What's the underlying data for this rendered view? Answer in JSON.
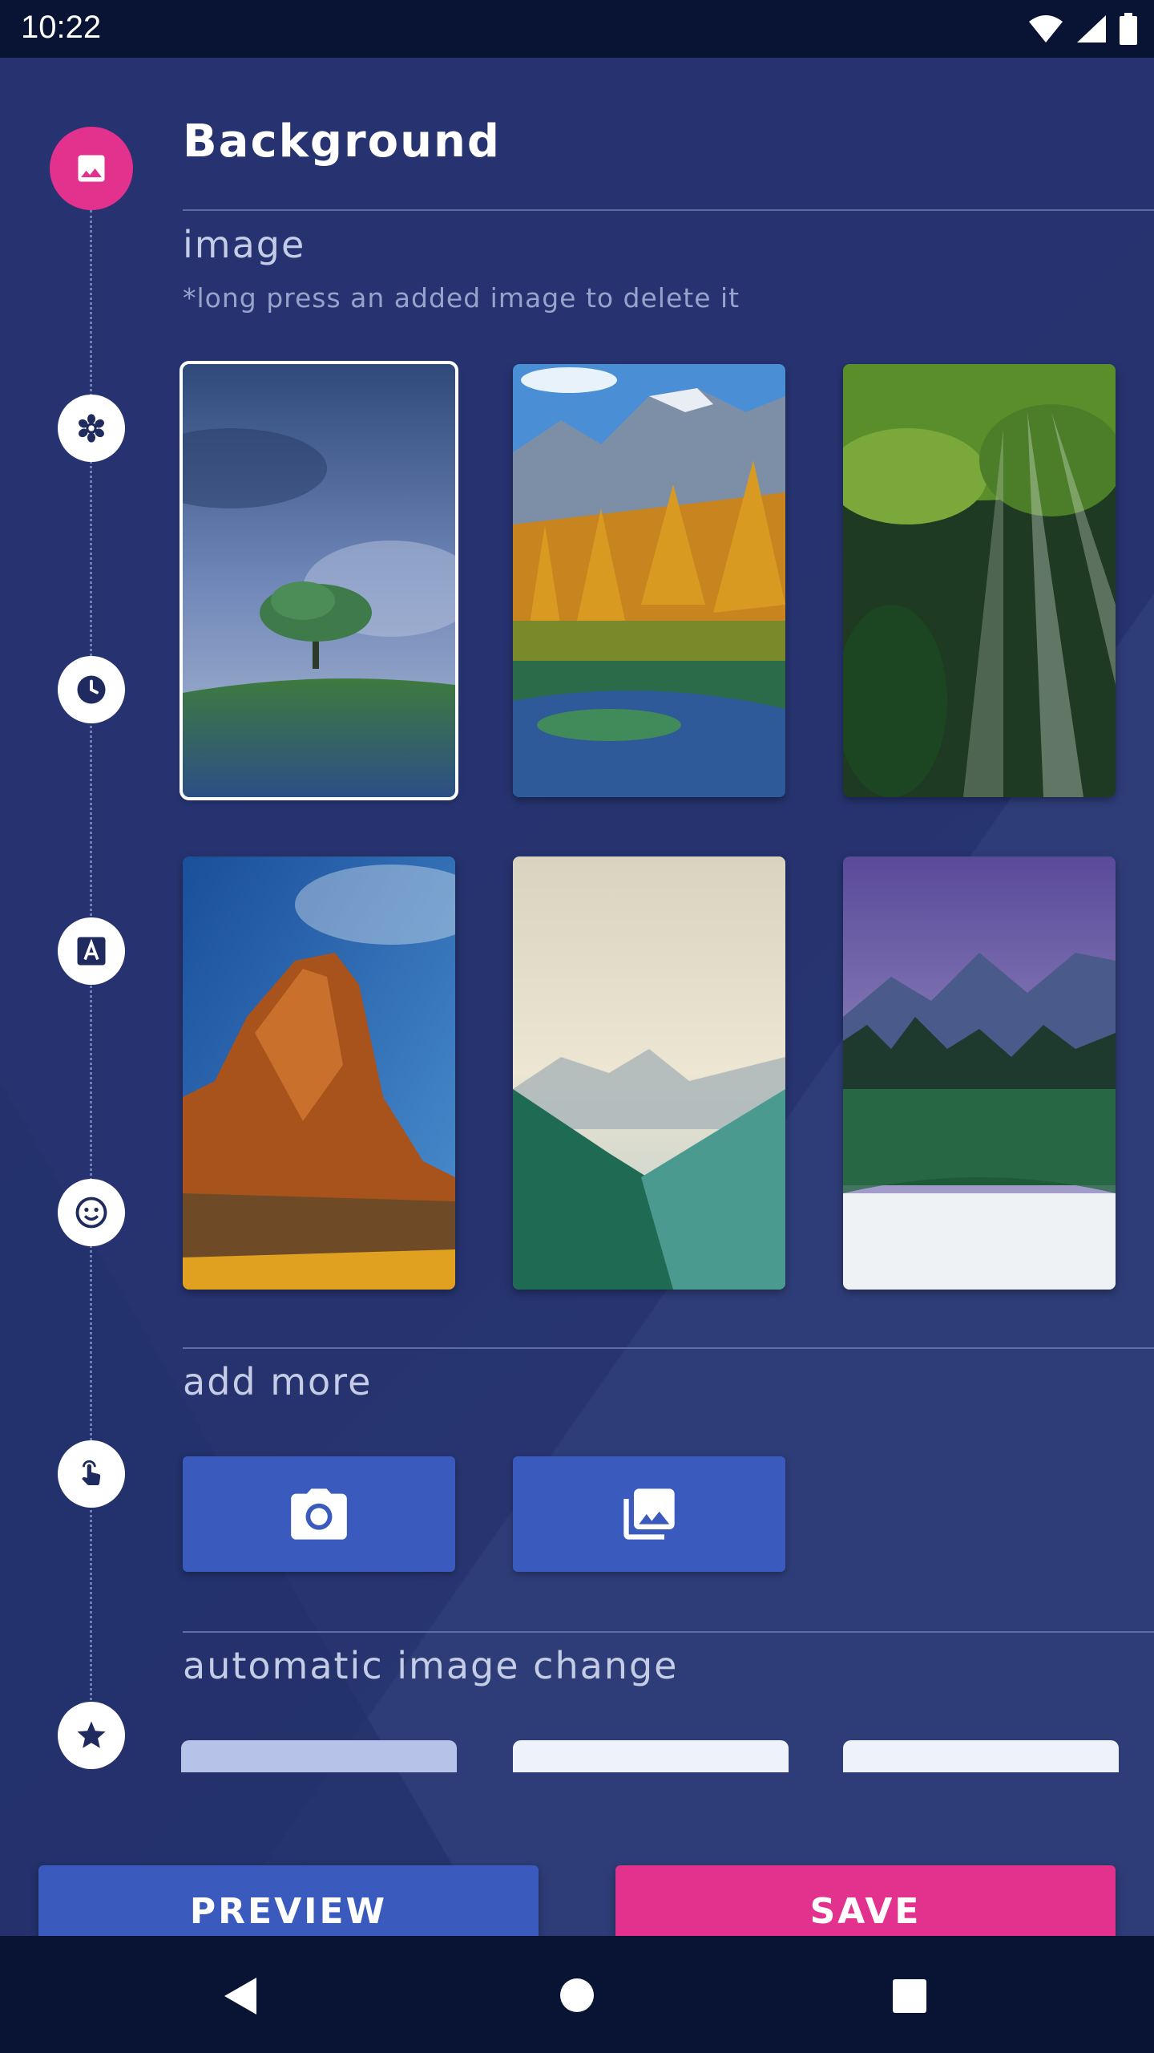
{
  "status_bar": {
    "time": "10:22",
    "icons": [
      "wifi-icon",
      "signal-icon",
      "battery-icon"
    ]
  },
  "steps": [
    {
      "icon": "image-icon",
      "active": true
    },
    {
      "icon": "settings-icon",
      "active": false
    },
    {
      "icon": "clock-icon",
      "active": false
    },
    {
      "icon": "text-icon",
      "active": false
    },
    {
      "icon": "emoji-icon",
      "active": false
    },
    {
      "icon": "touch-icon",
      "active": false
    },
    {
      "icon": "star-icon",
      "active": false
    }
  ],
  "header": {
    "title": "Background"
  },
  "image_section": {
    "label": "image",
    "hint": "*long press an added image to delete it",
    "thumbnails": [
      {
        "name": "stormy-tree",
        "selected": true
      },
      {
        "name": "autumn-mountain-lake",
        "selected": false
      },
      {
        "name": "forest-sunrays",
        "selected": false
      },
      {
        "name": "red-rock-desert",
        "selected": false
      },
      {
        "name": "misty-mountains",
        "selected": false
      },
      {
        "name": "lake-reflection-night",
        "selected": false
      }
    ]
  },
  "add_more": {
    "label": "add more",
    "buttons": [
      "camera-icon",
      "gallery-icon"
    ]
  },
  "auto_change": {
    "label": "automatic image change"
  },
  "actions": {
    "preview": "PREVIEW",
    "save": "SAVE"
  },
  "colors": {
    "accent_pink": "#e3318e",
    "button_blue": "#3a5bbd",
    "background": "#263470",
    "bar_dark": "#091333"
  },
  "navigation": [
    "back-icon",
    "home-icon",
    "recents-icon"
  ]
}
